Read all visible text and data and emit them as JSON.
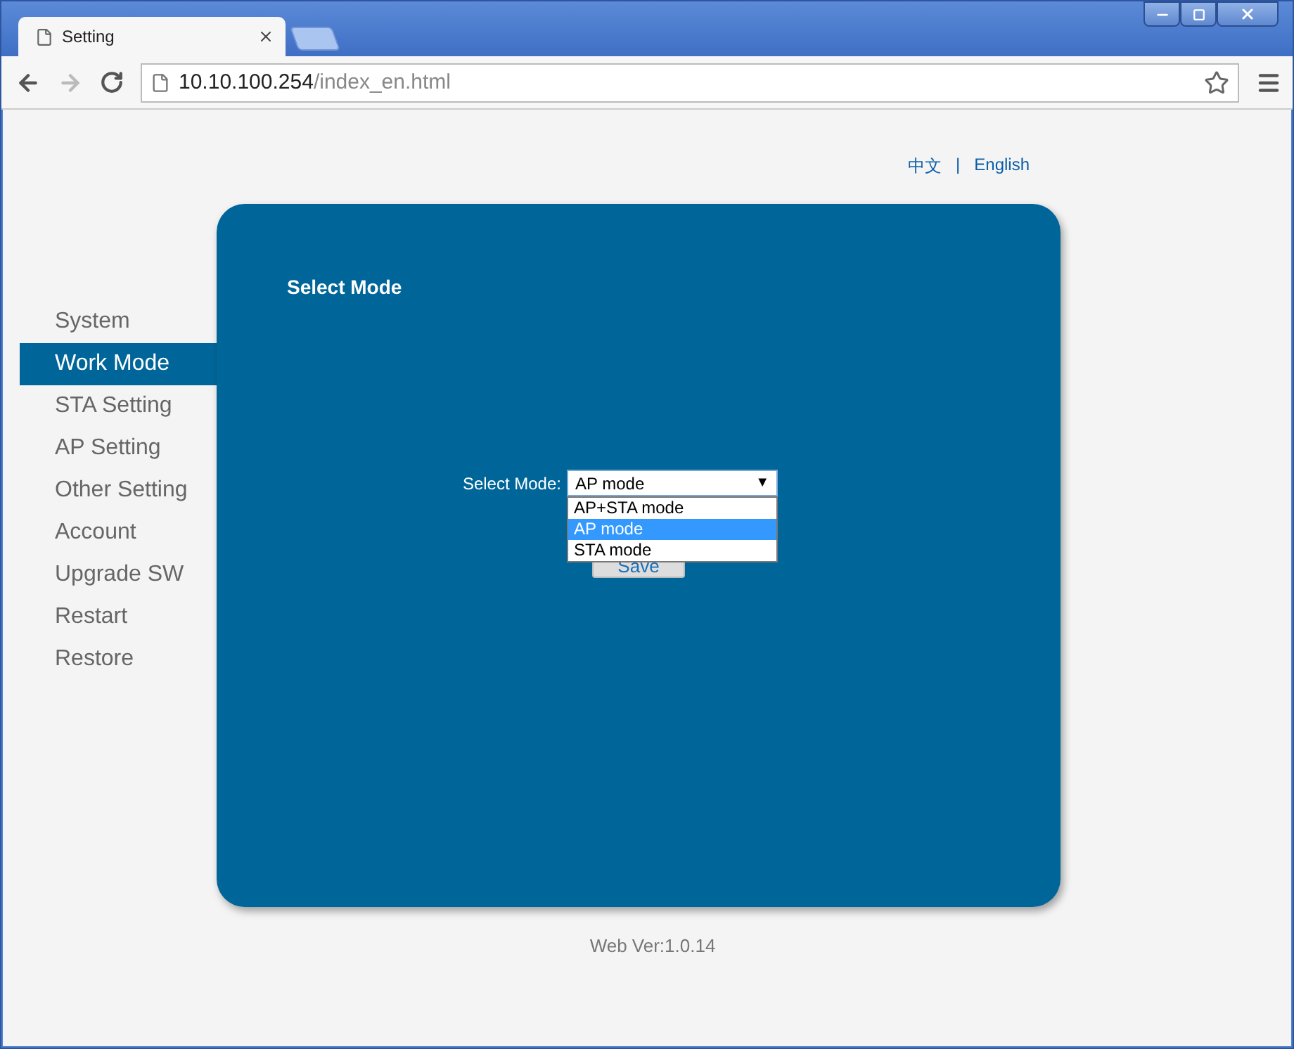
{
  "browser": {
    "tab_title": "Setting",
    "url_host": "10.10.100.254",
    "url_path": "/index_en.html",
    "forward_disabled": true
  },
  "languages": [
    {
      "label": "中文"
    },
    {
      "label": "English"
    }
  ],
  "language_separator": "|",
  "sidebar": [
    {
      "label": "System",
      "selected": false
    },
    {
      "label": "Work Mode",
      "selected": true
    },
    {
      "label": "STA Setting",
      "selected": false
    },
    {
      "label": "AP Setting",
      "selected": false
    },
    {
      "label": "Other Setting",
      "selected": false
    },
    {
      "label": "Account",
      "selected": false
    },
    {
      "label": "Upgrade SW",
      "selected": false
    },
    {
      "label": "Restart",
      "selected": false
    },
    {
      "label": "Restore",
      "selected": false
    }
  ],
  "panel": {
    "title": "Select Mode",
    "field_label": "Select Mode:",
    "select_value": "AP mode",
    "select_arrow": "▼",
    "expanded": true,
    "options": [
      {
        "label": "AP+STA mode",
        "selected": false
      },
      {
        "label": "AP mode",
        "selected": true
      },
      {
        "label": "STA mode",
        "selected": false
      }
    ],
    "save_button": "Save"
  },
  "footer": "Web Ver:1.0.14"
}
